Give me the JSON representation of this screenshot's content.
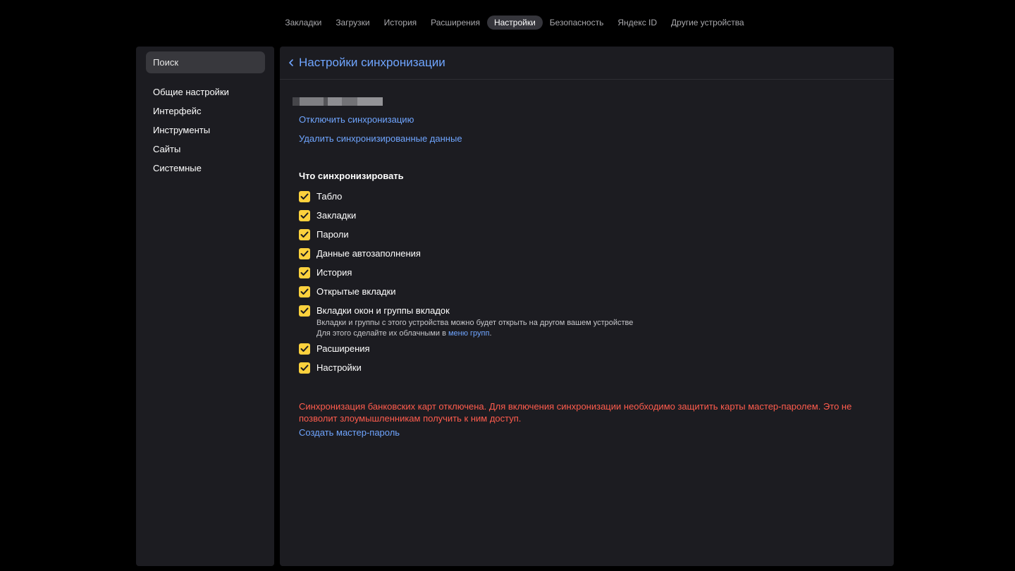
{
  "topnav": {
    "tabs": [
      {
        "label": "Закладки"
      },
      {
        "label": "Загрузки"
      },
      {
        "label": "История"
      },
      {
        "label": "Расширения"
      },
      {
        "label": "Настройки",
        "active": true
      },
      {
        "label": "Безопасность"
      },
      {
        "label": "Яндекс ID"
      },
      {
        "label": "Другие устройства"
      }
    ]
  },
  "sidebar": {
    "search_placeholder": "Поиск",
    "items": [
      {
        "label": "Общие настройки"
      },
      {
        "label": "Интерфейс"
      },
      {
        "label": "Инструменты"
      },
      {
        "label": "Сайты"
      },
      {
        "label": "Системные"
      }
    ]
  },
  "main": {
    "title": "Настройки синхронизации",
    "disable_sync_link": "Отключить синхронизацию",
    "delete_data_link": "Удалить синхронизированные данные",
    "section_title": "Что синхронизировать",
    "items": [
      {
        "label": "Табло",
        "checked": true
      },
      {
        "label": "Закладки",
        "checked": true
      },
      {
        "label": "Пароли",
        "checked": true
      },
      {
        "label": "Данные автозаполнения",
        "checked": true
      },
      {
        "label": "История",
        "checked": true
      },
      {
        "label": "Открытые вкладки",
        "checked": true
      },
      {
        "label": "Вкладки окон и группы вкладок",
        "checked": true
      },
      {
        "label": "Расширения",
        "checked": true
      },
      {
        "label": "Настройки",
        "checked": true
      }
    ],
    "tabs_hint": {
      "line1": "Вкладки и группы с этого устройства можно будет открыть на другом вашем устройстве",
      "line2_prefix": "Для этого сделайте их облачными в ",
      "line2_link": "меню групп",
      "line2_suffix": "."
    },
    "warning": "Синхронизация банковских карт отключена. Для включения синхронизации необходимо защитить карты мастер-паролем. Это не позволит злоумышленникам получить к ним доступ.",
    "create_master_password_link": "Создать мастер-пароль"
  },
  "colors": {
    "accent": "#6fa5ff",
    "checkbox": "#fcd13d",
    "warning": "#ff5c4d",
    "panel": "#1c1c21",
    "background": "#000000"
  }
}
